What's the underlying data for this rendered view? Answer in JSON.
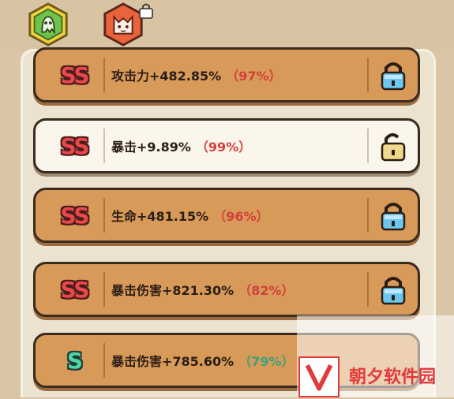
{
  "tabs": [
    {
      "icon": "ghost-icon",
      "active": true
    },
    {
      "icon": "cat-icon",
      "locked": true
    }
  ],
  "rows": [
    {
      "rank": "SS",
      "stat": "攻击力+482.85%",
      "percent": "（97%）",
      "locked": true,
      "selected": false
    },
    {
      "rank": "SS",
      "stat": "暴击+9.89%",
      "percent": "（99%）",
      "locked": false,
      "selected": true
    },
    {
      "rank": "SS",
      "stat": "生命+481.15%",
      "percent": "（96%）",
      "locked": true,
      "selected": false
    },
    {
      "rank": "SS",
      "stat": "暴击伤害+821.30%",
      "percent": "（82%）",
      "locked": true,
      "selected": false
    },
    {
      "rank": "S",
      "stat": "暴击伤害+785.60%",
      "percent": "（79%）",
      "locked": false,
      "selected": false
    }
  ],
  "watermark": {
    "text": "朝夕软件园"
  },
  "colors": {
    "row_bg": "#d89a59",
    "row_selected_bg": "#fbf6ec",
    "ss_red": "#e8484a",
    "s_green": "#4fd4a8",
    "pct_red": "#d2403c",
    "pct_green": "#3aa27e",
    "lock_blue": "#6cc7ee"
  }
}
